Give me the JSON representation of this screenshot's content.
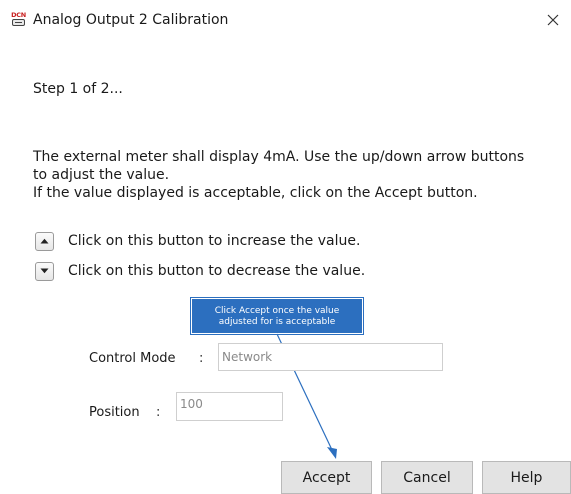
{
  "window": {
    "title": "Analog Output 2 Calibration",
    "app_icon_text": "DCN",
    "close_icon": "close-icon"
  },
  "step_text": "Step 1 of 2...",
  "instructions": {
    "line1": "The external meter shall display 4mA. Use the up/down arrow buttons",
    "line2": "to adjust the value.",
    "line3": "If the value displayed is acceptable, click on the Accept button."
  },
  "increase": {
    "icon": "arrow-up-icon",
    "label": "Click on this button to increase the value."
  },
  "decrease": {
    "icon": "arrow-down-icon",
    "label": "Click on this button to decrease the value."
  },
  "callout": {
    "line1": "Click Accept once the value",
    "line2": "adjusted for is acceptable",
    "color": "#2c6fbf"
  },
  "control_mode": {
    "label": "Control Mode",
    "separator": ":",
    "value": "Network"
  },
  "position": {
    "label": "Position",
    "separator": ":",
    "value": "100"
  },
  "buttons": {
    "accept": "Accept",
    "cancel": "Cancel",
    "help": "Help"
  }
}
